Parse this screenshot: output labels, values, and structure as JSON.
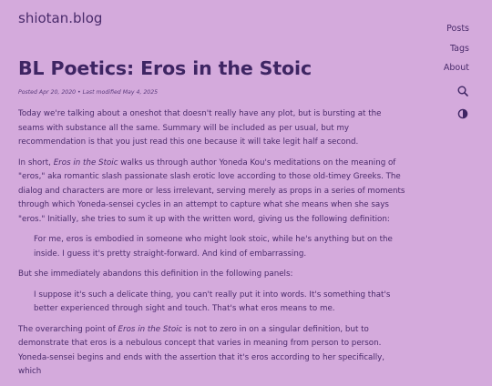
{
  "site": {
    "title": "shiotan.blog"
  },
  "nav": {
    "items": [
      {
        "label": "Posts"
      },
      {
        "label": "Tags"
      },
      {
        "label": "About"
      }
    ],
    "search_icon": "search-icon",
    "theme_icon": "contrast-icon"
  },
  "post": {
    "title": "BL Poetics: Eros in the Stoic",
    "meta": "Posted Apr 20, 2020 • Last modified May 4, 2025",
    "p1": "Today we're talking about a oneshot that doesn't really have any plot, but is bursting at the seams with substance all the same. Summary will be included as per usual, but my recommendation is that you just read this one because it will take legit half a second.",
    "p2_a": "In short, ",
    "p2_em": "Eros in the Stoic",
    "p2_b": " walks us through author Yoneda Kou's meditations on the meaning of \"eros,\" aka romantic slash passionate slash erotic love according to those old-timey Greeks. The dialog and characters are more or less irrelevant, serving merely as props in a series of moments through which Yoneda-sensei cycles in an attempt to capture what she means when she says \"eros.\" Initially, she tries to sum it up with the written word, giving us the following definition:",
    "quote1": "For me, eros is embodied in someone who might look stoic, while he's anything but on the inside. I guess it's pretty straight-forward. And kind of embarrassing.",
    "p3": "But she immediately abandons this definition in the following panels:",
    "quote2": "I suppose it's such a delicate thing, you can't really put it into words. It's something that's better experienced through sight and touch. That's what eros means to me.",
    "p4_a": "The overarching point of ",
    "p4_em": "Eros in the Stoic",
    "p4_b": " is not to zero in on a singular definition, but to demonstrate that eros is a nebulous concept that varies in meaning from person to person. Yoneda-sensei begins and ends with the assertion that it's eros according to her specifically, which"
  },
  "colors": {
    "background": "#d4aadc",
    "text": "#4a2b6b",
    "heading": "#3e2563"
  }
}
